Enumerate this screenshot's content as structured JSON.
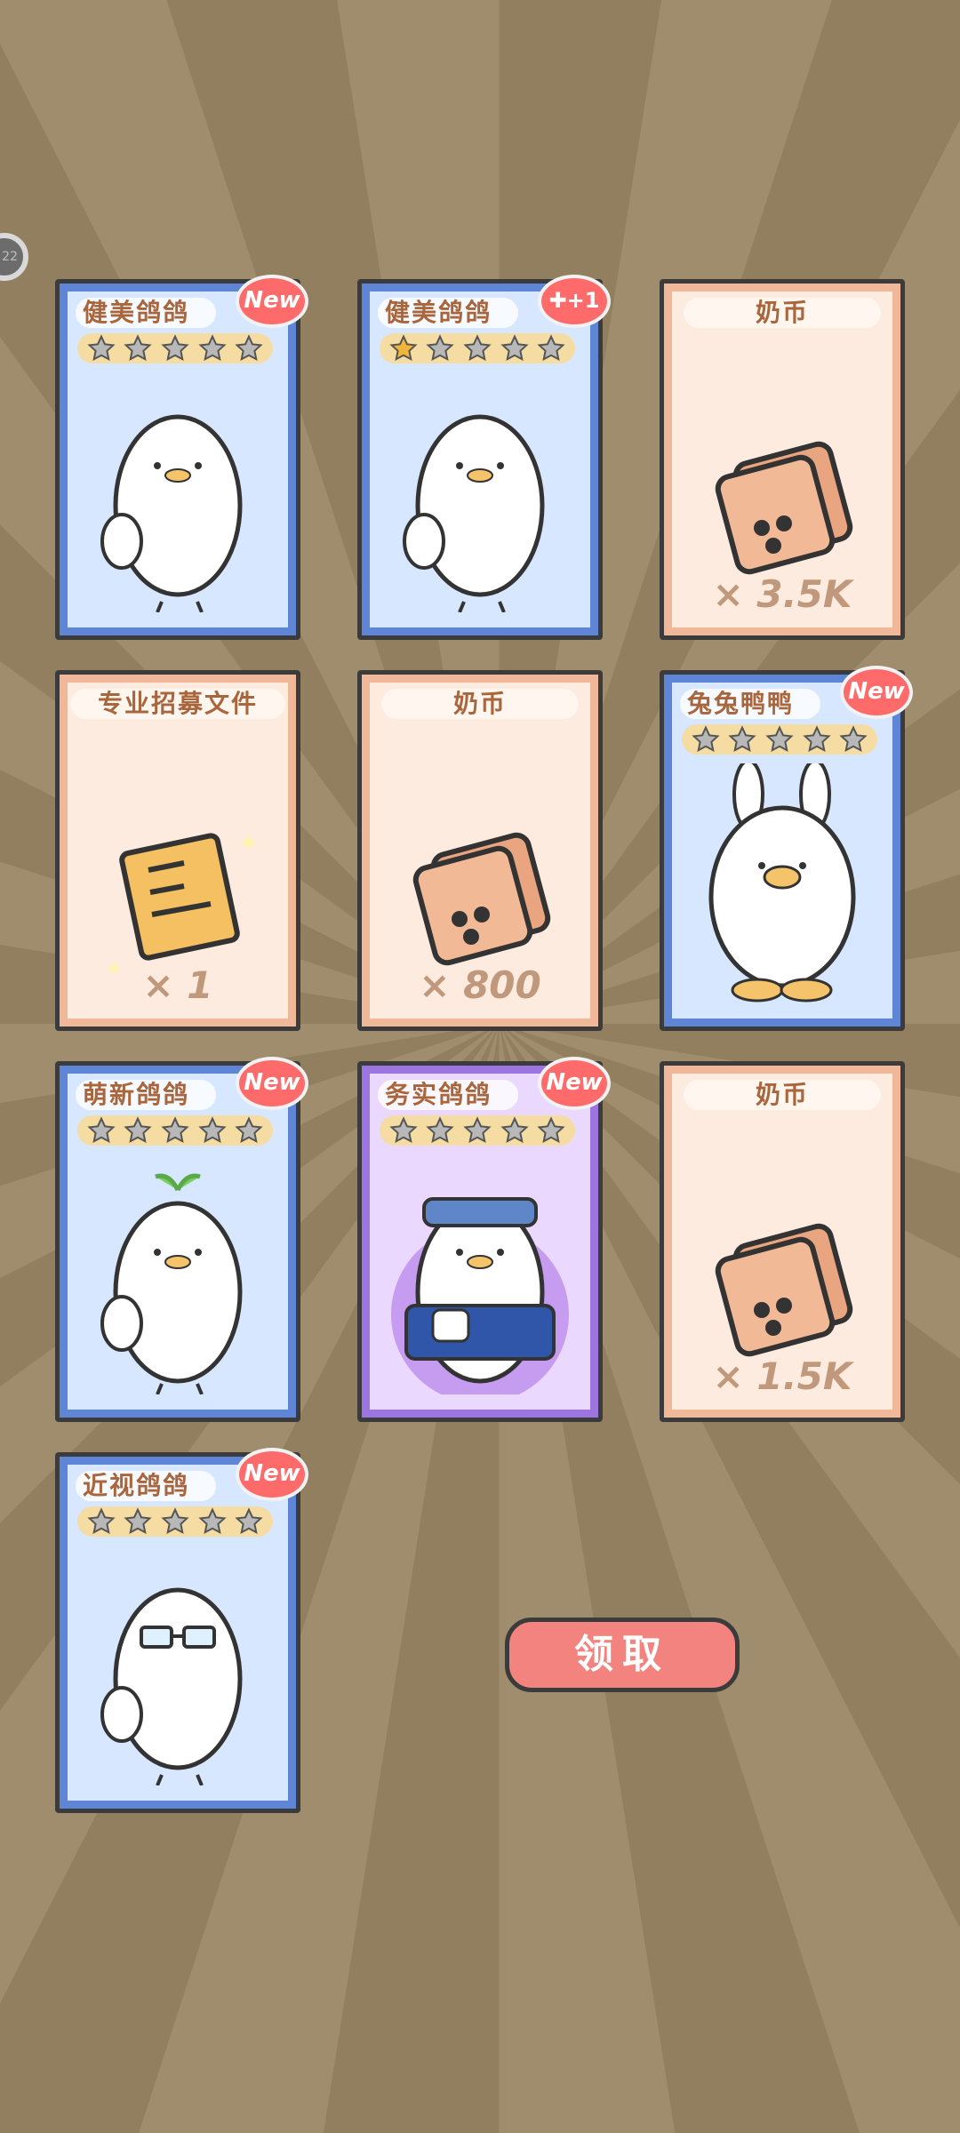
{
  "status": {
    "indicator_text": "22"
  },
  "cards": [
    {
      "type": "character",
      "name": "健美鸽鸽",
      "stars_filled": 0,
      "badge": "New",
      "color": "blue"
    },
    {
      "type": "character",
      "name": "健美鸽鸽",
      "stars_filled": 1,
      "badge": "+1",
      "color": "blue"
    },
    {
      "type": "currency",
      "name": "奶币",
      "quantity": "× 3.5K"
    },
    {
      "type": "item",
      "name": "专业招募文件",
      "quantity": "× 1"
    },
    {
      "type": "currency",
      "name": "奶币",
      "quantity": "× 800"
    },
    {
      "type": "character",
      "name": "兔兔鸭鸭",
      "stars_filled": 0,
      "badge": "New",
      "color": "blue"
    },
    {
      "type": "character",
      "name": "萌新鸽鸽",
      "stars_filled": 0,
      "badge": "New",
      "color": "blue"
    },
    {
      "type": "character",
      "name": "务实鸽鸽",
      "stars_filled": 0,
      "badge": "New",
      "color": "purple"
    },
    {
      "type": "currency",
      "name": "奶币",
      "quantity": "× 1.5K"
    },
    {
      "type": "character",
      "name": "近视鸽鸽",
      "stars_filled": 0,
      "badge": "New",
      "color": "blue"
    }
  ],
  "stars_total": 5,
  "claim_button": {
    "label": "领取"
  },
  "colors": {
    "background": "#9a8766",
    "badge": "#ff6b6b",
    "button": "#f3837f"
  }
}
